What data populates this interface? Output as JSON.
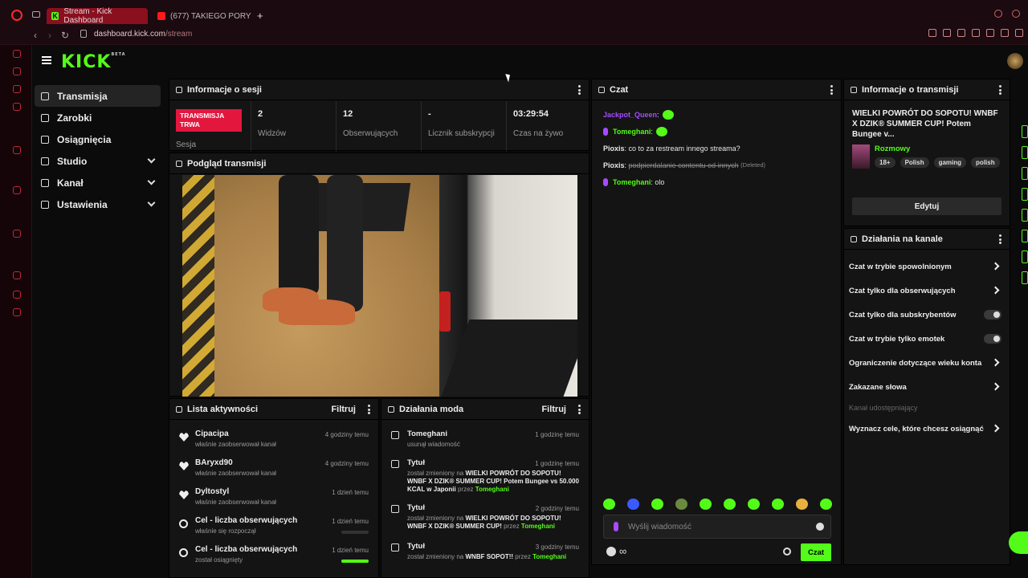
{
  "browser": {
    "tabs": [
      {
        "label": "Stream - Kick Dashboard",
        "active": true
      },
      {
        "label": "(677) TAKIEGO PORY",
        "active": false
      }
    ],
    "url_domain": "dashboard.kick.com",
    "url_path": "/stream"
  },
  "app": {
    "logo": "KICK",
    "logo_sup": "BETA"
  },
  "sidebar": {
    "items": [
      {
        "label": "Transmisja",
        "active": true
      },
      {
        "label": "Zarobki"
      },
      {
        "label": "Osiągnięcia"
      },
      {
        "label": "Studio",
        "expandable": true
      },
      {
        "label": "Kanał",
        "expandable": true
      },
      {
        "label": "Ustawienia",
        "expandable": true
      }
    ]
  },
  "session": {
    "title": "Informacje o sesji",
    "live_badge": "TRANSMISJA TRWA",
    "live_label": "Sesja",
    "stats": [
      {
        "value": "2",
        "label": "Widzów"
      },
      {
        "value": "12",
        "label": "Obserwujących"
      },
      {
        "value": "-",
        "label": "Licznik subskrypcji"
      },
      {
        "value": "03:29:54",
        "label": "Czas na żywo"
      }
    ]
  },
  "preview": {
    "title": "Podgląd transmisji"
  },
  "chat": {
    "title": "Czat",
    "messages": [
      {
        "user": "Jackpot_Queen",
        "text": "",
        "color": "#a64bff"
      },
      {
        "user": "Tomeghani",
        "text": "",
        "color": "#53fc18"
      },
      {
        "user": "Pioxis",
        "text": "co to za restream innego streama?",
        "color": "#eeeeee"
      },
      {
        "user": "Pioxis",
        "text": "podpierdalanie contentu od innych",
        "deleted": "(Deleted)",
        "color": "#eeeeee"
      },
      {
        "user": "Tomeghani",
        "text": "olo",
        "color": "#53fc18"
      }
    ],
    "input_placeholder": "Wyślij wiadomość",
    "send_label": "Czat",
    "infinity": "∞"
  },
  "activity": {
    "title": "Lista aktywności",
    "filter": "Filtruj",
    "items": [
      {
        "name": "Cipacipa",
        "desc": "właśnie zaobserwował kanał",
        "time": "4 godziny temu"
      },
      {
        "name": "BAryxd90",
        "desc": "właśnie zaobserwował kanał",
        "time": "4 godziny temu"
      },
      {
        "name": "Dyltostyl",
        "desc": "właśnie zaobserwował kanał",
        "time": "1 dzień temu"
      },
      {
        "name": "Cel - liczba obserwujących",
        "desc": "właśnie się rozpoczął",
        "time": "1 dzień temu",
        "progress": 0
      },
      {
        "name": "Cel - liczba obserwujących",
        "desc": "został osiągnięty",
        "time": "1 dzień temu",
        "progress": 1
      }
    ]
  },
  "mod": {
    "title": "Działania moda",
    "filter": "Filtruj",
    "items": [
      {
        "title": "Tomeghani",
        "time": "1 godzinę temu",
        "desc": "usunął wiadomość"
      },
      {
        "title": "Tytuł",
        "time": "1 godzinę temu",
        "pre": "został zmieniony na",
        "value": "WIELKI POWRÓT DO SOPOTU! WNBF X DZIK® SUMMER CUP! Potem Bungee vs 50.000 KCAL w Japonii",
        "by": "przez",
        "user": "Tomeghani"
      },
      {
        "title": "Tytuł",
        "time": "2 godziny temu",
        "pre": "został zmieniony na",
        "value": "WIELKI POWRÓT DO SOPOTU! WNBF X DZIK® SUMMER CUP!",
        "by": "przez",
        "user": "Tomeghani"
      },
      {
        "title": "Tytuł",
        "time": "3 godziny temu",
        "pre": "został zmieniony na",
        "value": "WNBF SOPOT!!",
        "by": "przez",
        "user": "Tomeghani"
      }
    ]
  },
  "stream_info": {
    "title": "Informacje o transmisji",
    "stream_title": "WIELKI POWRÓT DO SOPOTU! WNBF X DZIK® SUMMER CUP! Potem Bungee v...",
    "category": "Rozmowy",
    "tags": [
      "18+",
      "Polish",
      "gaming",
      "polish"
    ],
    "edit": "Edytuj"
  },
  "channel_actions": {
    "title": "Działania na kanale",
    "items": [
      {
        "label": "Czat w trybie spowolnionym",
        "type": "arrow"
      },
      {
        "label": "Czat tylko dla obserwujących",
        "type": "arrow"
      },
      {
        "label": "Czat tylko dla subskrybentów",
        "type": "toggle"
      },
      {
        "label": "Czat w trybie tylko emotek",
        "type": "toggle"
      },
      {
        "label": "Ograniczenie dotyczące wieku konta",
        "type": "arrow"
      },
      {
        "label": "Zakazane słowa",
        "type": "arrow"
      },
      {
        "label": "Kanał udostępniający",
        "type": "muted"
      },
      {
        "label": "Wyznacz cele, które chcesz osiągnąć",
        "type": "arrow"
      }
    ]
  }
}
